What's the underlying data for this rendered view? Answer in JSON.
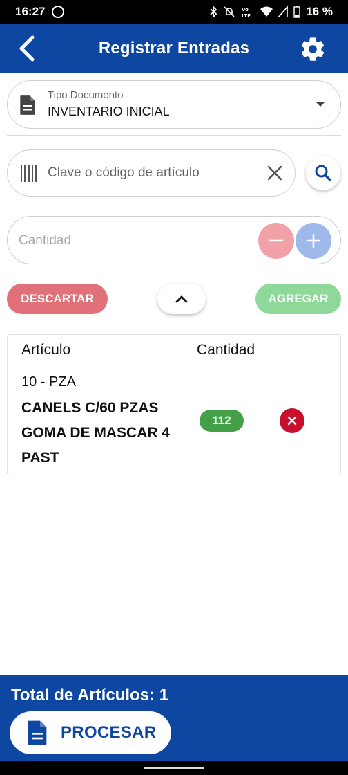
{
  "status_bar": {
    "time": "16:27",
    "battery": "16 %",
    "icons": [
      "whatsapp-icon",
      "bluetooth-icon",
      "mute-icon",
      "volte-icon",
      "wifi-icon",
      "signal-icon",
      "battery-icon"
    ]
  },
  "app_bar": {
    "title": "Registrar Entradas",
    "back_icon": "chevron-left-icon",
    "settings_icon": "gear-icon"
  },
  "doc_type": {
    "label": "Tipo Documento",
    "value": "INVENTARIO INICIAL",
    "icon": "document-icon"
  },
  "search": {
    "placeholder": "Clave o código de artículo",
    "icon": "barcode-icon"
  },
  "quantity": {
    "placeholder": "Cantidad"
  },
  "actions": {
    "discard_label": "DESCARTAR",
    "add_label": "AGREGAR"
  },
  "table": {
    "headers": {
      "article": "Artículo",
      "quantity": "Cantidad"
    },
    "rows": [
      {
        "code": "10 - PZA",
        "description": "CANELS C/60 PZAS GOMA DE MASCAR 4 PAST",
        "quantity": "112"
      }
    ]
  },
  "footer": {
    "total_text": "Total de Artículos: 1",
    "process_label": "PROCESAR"
  },
  "colors": {
    "primary": "#0d47a1",
    "discard": "#e07179",
    "add": "#8ed89a",
    "badge": "#43a047",
    "remove": "#c8102e"
  }
}
